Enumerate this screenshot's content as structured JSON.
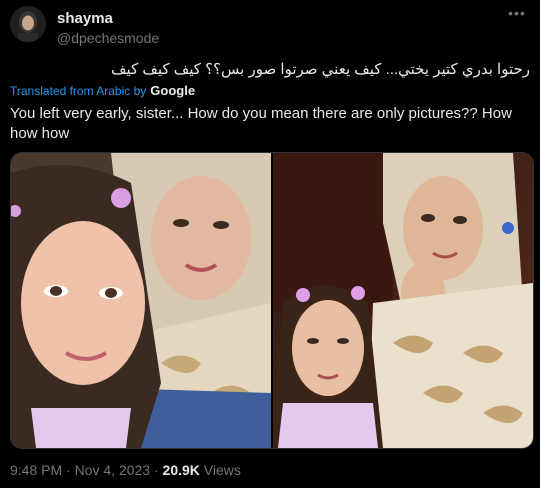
{
  "user": {
    "display_name": "shayma",
    "handle": "@dpechesmode"
  },
  "tweet": {
    "original_text": "رحتوا بدري كتير يختي... كيف يعني صرتوا صور بس؟؟ كيف كيف كيف",
    "translated_label": "Translated from Arabic by",
    "translation_provider": "Google",
    "translation": "You left very early, sister... How do you mean there are only pictures?? How how how"
  },
  "media": {
    "photos": [
      {
        "label": "photo-1"
      },
      {
        "label": "photo-2"
      }
    ]
  },
  "footer": {
    "time": "9:48 PM",
    "separator": " · ",
    "date": "Nov 4, 2023",
    "views_count": "20.9K",
    "views_label": "Views"
  },
  "icons": {
    "more": "more-icon"
  },
  "colors": {
    "background": "#000000",
    "text": "#e7e9ea",
    "secondary": "#71767b",
    "link": "#1d9bf0"
  }
}
